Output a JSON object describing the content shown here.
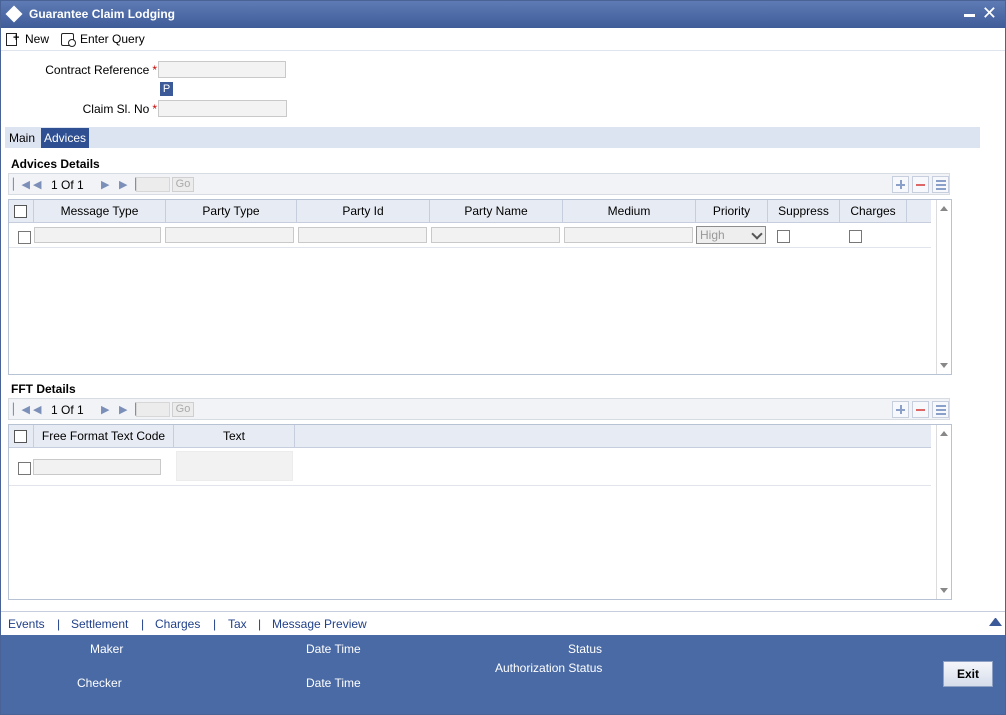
{
  "window": {
    "title": "Guarantee Claim Lodging"
  },
  "toolbar": {
    "new_label": "New",
    "enter_query_label": "Enter Query"
  },
  "header": {
    "contract_reference_label": "Contract Reference",
    "claim_sl_no_label": "Claim Sl. No",
    "required_mark": "*",
    "p_button_label": "P",
    "contract_reference_value": "",
    "claim_sl_no_value": ""
  },
  "tabs": [
    {
      "label": "Main",
      "active": false
    },
    {
      "label": "Advices",
      "active": true
    }
  ],
  "advices": {
    "section_title": "Advices Details",
    "pager": {
      "page": "1",
      "of_label": "Of",
      "total": "1",
      "go_label": "Go"
    },
    "columns": [
      "Message Type",
      "Party Type",
      "Party Id",
      "Party Name",
      "Medium",
      "Priority",
      "Suppress",
      "Charges"
    ],
    "rows": [
      {
        "message_type": "",
        "party_type": "",
        "party_id": "",
        "party_name": "",
        "medium": "",
        "priority": "High",
        "suppress": false,
        "charges": false
      }
    ]
  },
  "fft": {
    "section_title": "FFT Details",
    "pager": {
      "page": "1",
      "of_label": "Of",
      "total": "1",
      "go_label": "Go"
    },
    "columns": [
      "Free Format Text Code",
      "Text"
    ],
    "rows": [
      {
        "code": "",
        "text": ""
      }
    ]
  },
  "footer_links": [
    "Events",
    "Settlement",
    "Charges",
    "Tax",
    "Message Preview"
  ],
  "status": {
    "maker_label": "Maker",
    "checker_label": "Checker",
    "date_time_label": "Date Time",
    "status_label": "Status",
    "authorization_status_label": "Authorization Status",
    "exit_label": "Exit"
  },
  "colors": {
    "title_bar": "#3f5c99",
    "tab_active": "#2e4f91",
    "status_bar": "#4a6aa5",
    "link": "#22418a",
    "required": "#cc0000"
  }
}
